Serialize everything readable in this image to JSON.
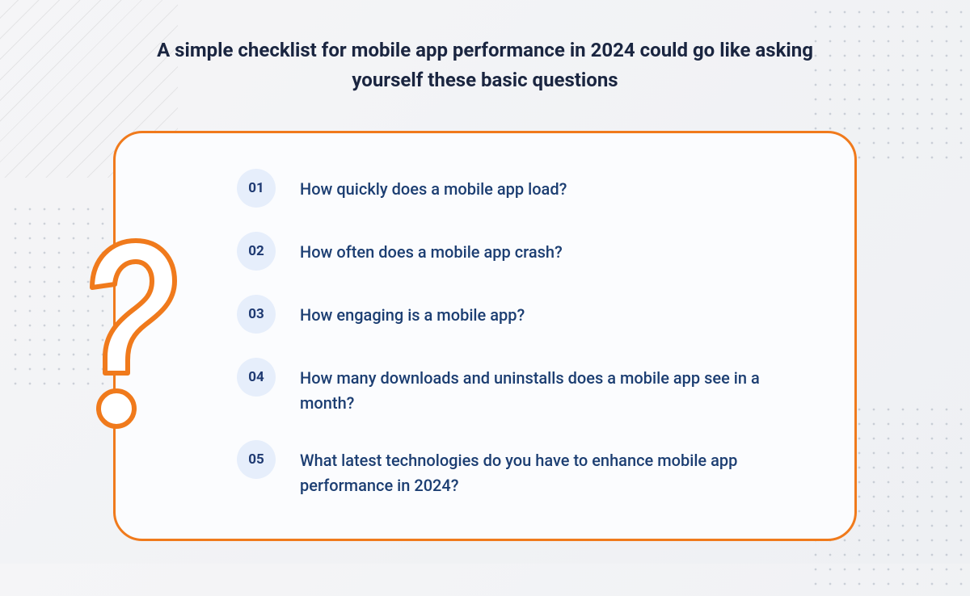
{
  "heading": "A simple checklist for mobile app performance in 2024 could go like asking yourself these basic questions",
  "colors": {
    "accent": "#f07a1c",
    "text_primary": "#1a2540",
    "text_item": "#1c3e72",
    "badge_bg": "#e6eefb"
  },
  "items": [
    {
      "num": "01",
      "text": "How quickly does a mobile app load?"
    },
    {
      "num": "02",
      "text": "How often does a mobile app crash?"
    },
    {
      "num": "03",
      "text": "How engaging is a mobile app?"
    },
    {
      "num": "04",
      "text": "How many downloads and uninstalls does a mobile app see in a month?"
    },
    {
      "num": "05",
      "text": "What latest technologies do you have to enhance mobile app performance in 2024?"
    }
  ]
}
